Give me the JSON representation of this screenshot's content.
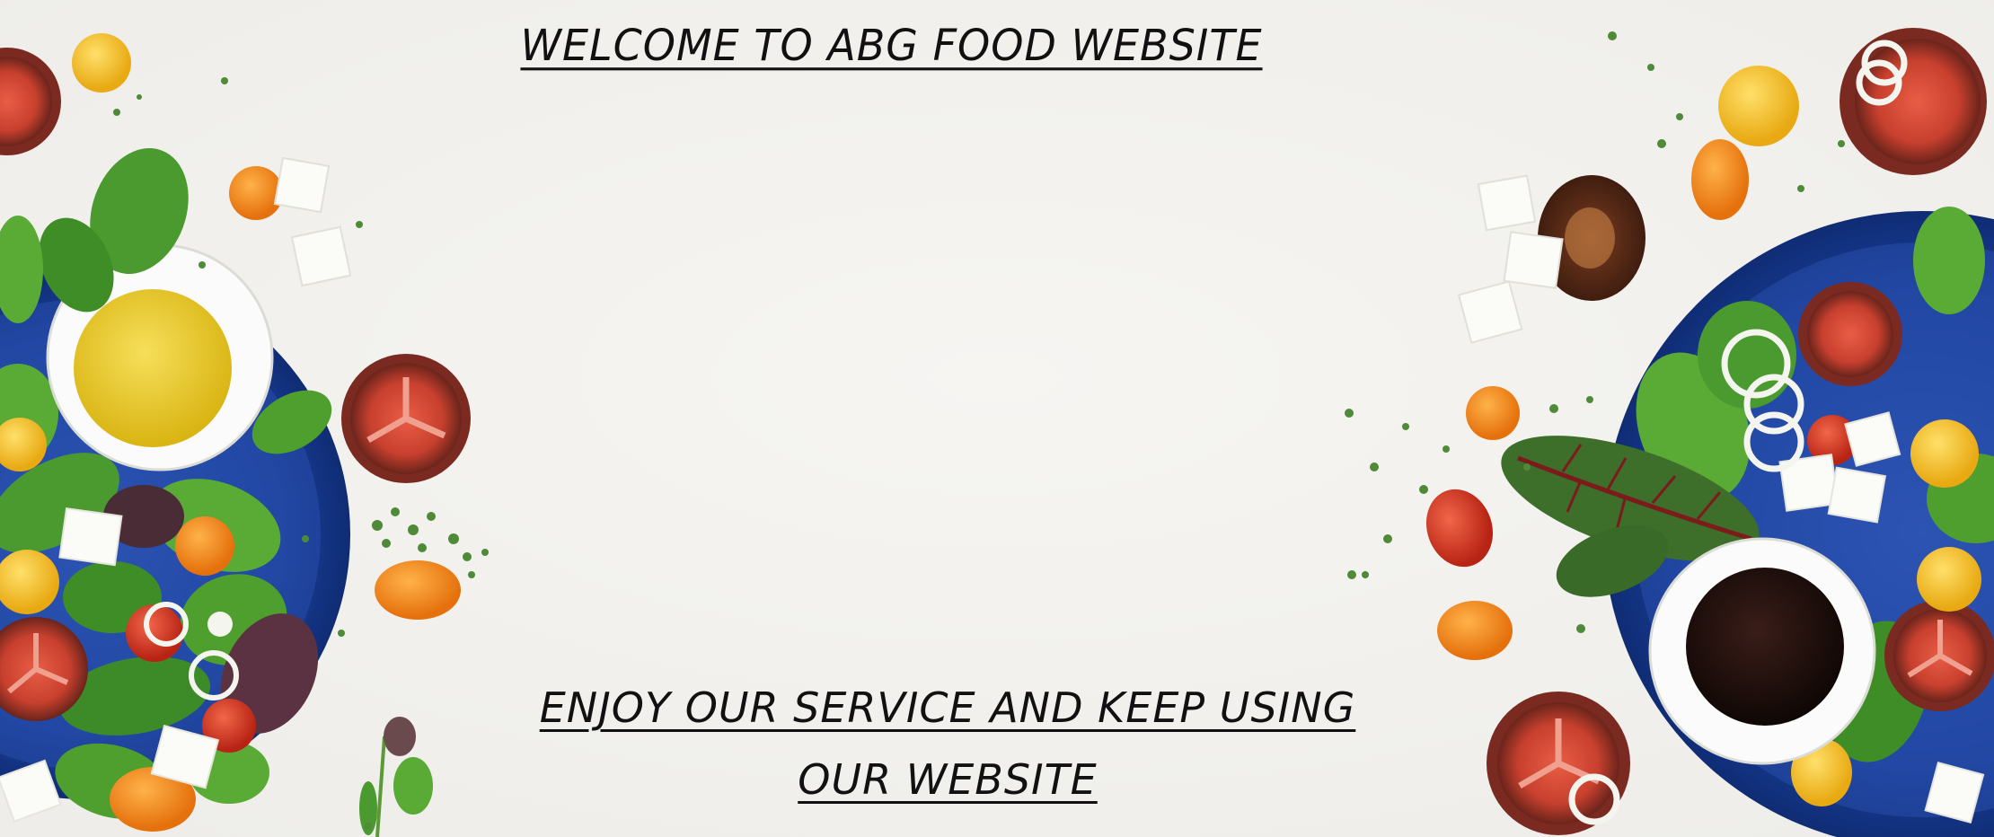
{
  "page": {
    "background_color": "#f3f2ef",
    "welcome_heading": "WELCOME TO ABG FOOD WEBSITE",
    "closing_line_1": "ENJOY OUR SERVICE AND KEEP USING",
    "closing_line_2": "OUR WEBSITE"
  },
  "decor": {
    "plate_color": "#1a3f9a",
    "plate_rim_color": "#0f2c74",
    "bowl_color": "#fbfbfb",
    "olive_oil_color": "#e8c61d",
    "balsamic_color": "#1c0e0c",
    "leaf_color": "#4a9a2f",
    "leaf_dark_color": "#2f7a1f",
    "tomato_color": "#c8402e",
    "tomato_dark_color": "#7a2a20",
    "cherry_yellow_color": "#f2bf23",
    "cherry_orange_color": "#f08a17",
    "cherry_red_color": "#d93a24",
    "feta_color": "#fbfbf7",
    "micro_green_color": "#4e8a37",
    "chard_color": "#3d6e2a",
    "chard_vein_color": "#7b1b1b",
    "sauce_color": "#4a2414"
  }
}
